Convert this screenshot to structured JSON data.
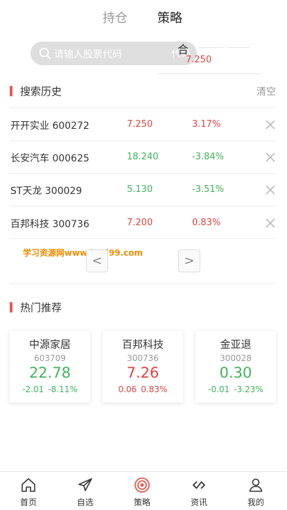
{
  "header": {
    "tabs": [
      {
        "label": "持仓"
      },
      {
        "label": "策略"
      }
    ]
  },
  "search": {
    "placeholder": "请输入股票代码",
    "overlay_label": "代码",
    "overlay_head": "合",
    "overlay_price": "7.250"
  },
  "history": {
    "title": "搜索历史",
    "clear_label": "清空",
    "rows": [
      {
        "name": "开开实业 600272",
        "price": "7.250",
        "change": "3.17%"
      },
      {
        "name": "长安汽车 000625",
        "price": "18.240",
        "change": "-3.84%"
      },
      {
        "name": "ST天龙 300029",
        "price": "5.130",
        "change": "-3.51%"
      },
      {
        "name": "百邦科技 300736",
        "price": "7.200",
        "change": "0.83%"
      }
    ],
    "prev_label": "<",
    "next_label": ">"
  },
  "watermark": "学习资源网www.bori99.com",
  "hot": {
    "title": "热门推荐",
    "cards": [
      {
        "name": "中源家居",
        "code": "603709",
        "price": "22.78",
        "chg": "-2.01",
        "pct": "-8.11%"
      },
      {
        "name": "百邦科技",
        "code": "300736",
        "price": "7.26",
        "chg": "0.06",
        "pct": "0.83%"
      },
      {
        "name": "金亚退",
        "code": "300028",
        "price": "0.30",
        "chg": "-0.01",
        "pct": "-3.23%"
      }
    ]
  },
  "nav": {
    "items": [
      {
        "label": "首页",
        "icon": "home-icon"
      },
      {
        "label": "自选",
        "icon": "paper-plane-icon"
      },
      {
        "label": "策略",
        "icon": "target-icon"
      },
      {
        "label": "资讯",
        "icon": "link-icon"
      },
      {
        "label": "我的",
        "icon": "user-icon"
      }
    ]
  },
  "colors": {
    "up": "#e04343",
    "down": "#3fb35a",
    "accent": "#e55a4e"
  }
}
